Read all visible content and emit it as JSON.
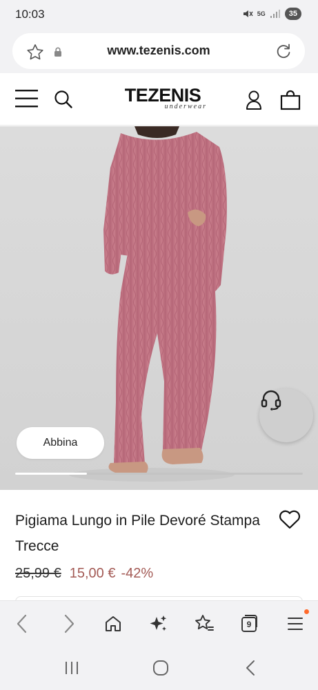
{
  "status_bar": {
    "time": "10:03",
    "network": "5G",
    "battery": "35"
  },
  "browser": {
    "url": "www.tezenis.com",
    "tab_count": "9",
    "icons": [
      "star-icon",
      "lock-icon",
      "reload-icon",
      "back-icon",
      "forward-icon",
      "home-icon",
      "sparkle-icon",
      "bookmark-star-icon",
      "tabs-icon",
      "menu-icon"
    ]
  },
  "site": {
    "logo_main": "TEZENIS",
    "logo_sub": "underwear"
  },
  "gallery": {
    "abbina_label": "Abbina",
    "progress_fraction": 0.25
  },
  "product": {
    "title": "Pigiama Lungo in Pile Devoré Stampa Trecce",
    "price_old": "25,99 €",
    "price_new": "15,00 €",
    "discount": "-42%"
  },
  "colors": {
    "accent_price": "#a35a55",
    "pajama": "#c07482",
    "background_chrome": "#f2f2f4"
  }
}
